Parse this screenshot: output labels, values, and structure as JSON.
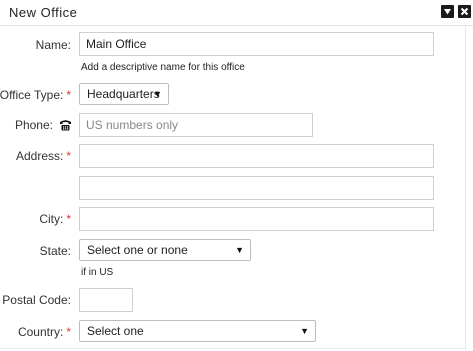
{
  "window": {
    "title": "New Office",
    "collapse_icon": "collapse-triangle-icon",
    "close_icon": "close-x-icon"
  },
  "form": {
    "name": {
      "label": "Name:",
      "value": "Main Office",
      "hint": "Add a descriptive name for this office"
    },
    "office_type": {
      "label": "Office Type:",
      "required_mark": "*",
      "selected": "Headquarters"
    },
    "phone": {
      "label": "Phone:",
      "icon": "telephone-icon",
      "value": "",
      "placeholder": "US numbers only"
    },
    "address": {
      "label": "Address:",
      "required_mark": "*",
      "line1": "",
      "line2": ""
    },
    "city": {
      "label": "City:",
      "required_mark": "*",
      "value": ""
    },
    "state": {
      "label": "State:",
      "selected": "Select one or none",
      "hint": "if in US"
    },
    "postal_code": {
      "label": "Postal Code:",
      "value": ""
    },
    "country": {
      "label": "Country:",
      "required_mark": "*",
      "selected": "Select one"
    }
  },
  "colors": {
    "required": "#dd3333",
    "border": "#cfcfcf",
    "title_buttons": "#1a1a1a"
  }
}
